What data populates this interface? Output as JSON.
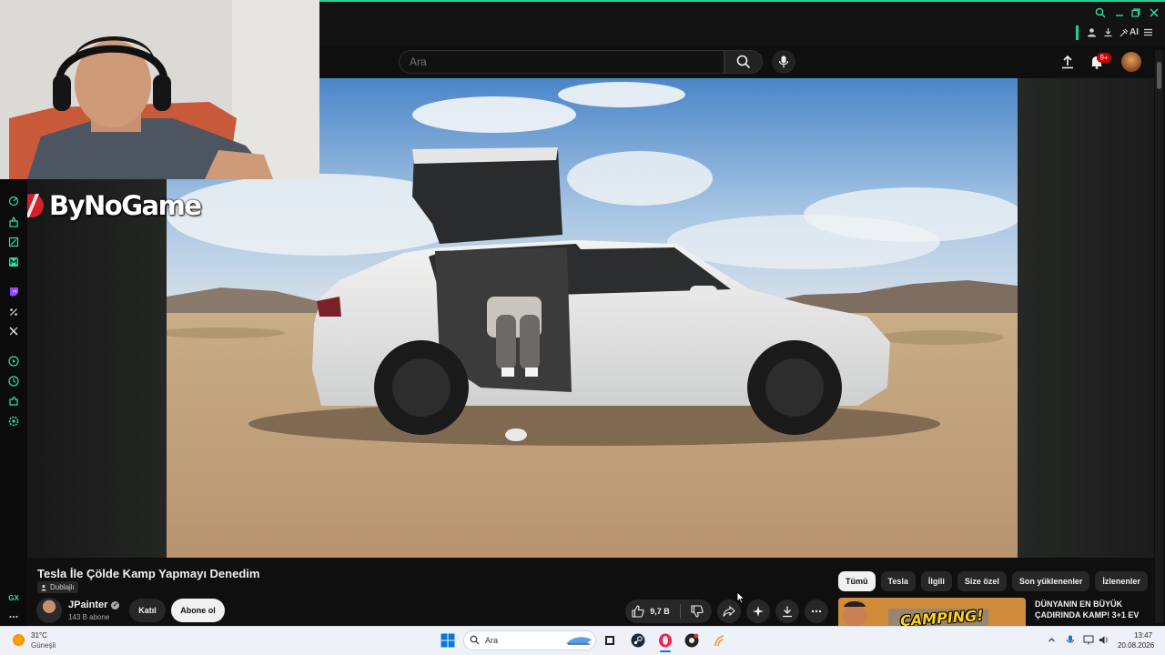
{
  "search": {
    "placeholder": "Ara"
  },
  "header": {
    "notification_count": "9+"
  },
  "overlay": {
    "logo_text": "ByNoGame"
  },
  "video": {
    "title": "Tesla İle Çölde Kamp Yapmayı Denedim",
    "dubbed_label": "Dublajlı",
    "channel_name": "JPainter",
    "subscribers": "143 B abone",
    "join_label": "Katıl",
    "subscribe_label": "Abone ol",
    "likes": "9,7 B"
  },
  "chips": [
    {
      "label": "Tümü",
      "active": true
    },
    {
      "label": "Tesla"
    },
    {
      "label": "İlgili"
    },
    {
      "label": "Size özel"
    },
    {
      "label": "Son yüklenenler"
    },
    {
      "label": "İzlenenler"
    }
  ],
  "recommendation": {
    "title": "DÜNYANIN EN BÜYÜK ÇADIRINDA KAMP! 3+1 EV",
    "thumb_text": "CAMPING!"
  },
  "browser": {
    "ai_label": "AI",
    "gx_label": "GX"
  },
  "taskbar": {
    "weather_temp": "31°C",
    "weather_cond": "Güneşli",
    "search_label": "Ara",
    "time": "13:47",
    "date": "20.08.2026"
  },
  "colors": {
    "accent": "#1fd19a",
    "notification": "#cc0000",
    "youtube_bg": "#0f0f0f"
  }
}
